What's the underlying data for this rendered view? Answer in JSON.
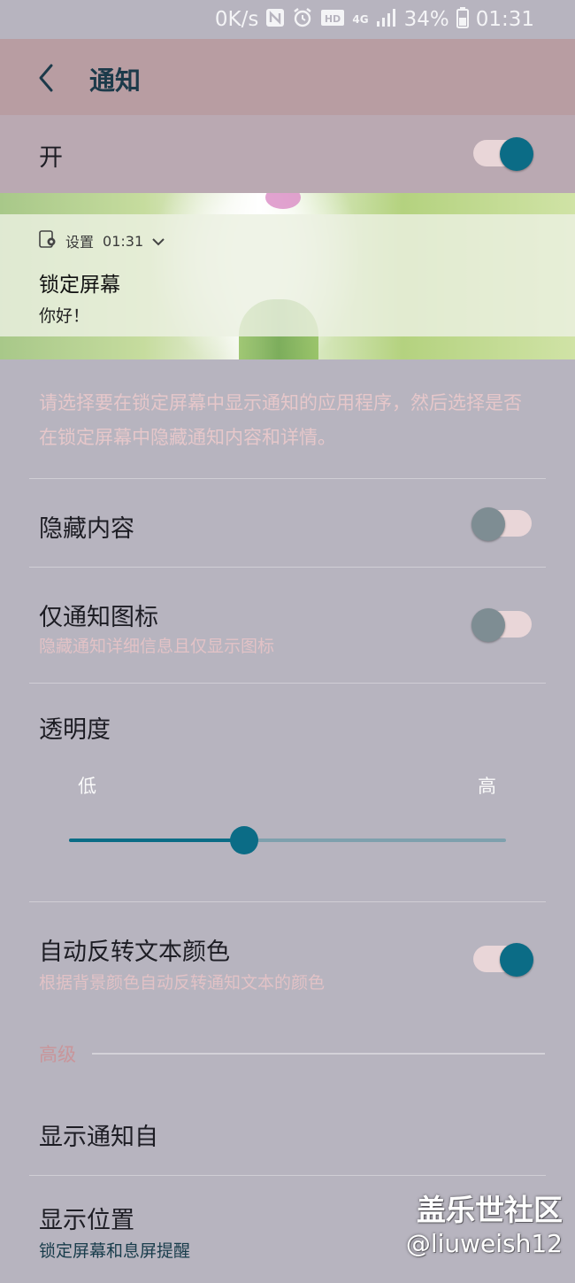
{
  "status_bar": {
    "net_speed": "0K/s",
    "icons": [
      "nfc-icon",
      "alarm-icon",
      "hd-voice-icon",
      "4g-icon",
      "signal-icon",
      "battery-icon"
    ],
    "hd_label": "HD",
    "lte_label": "4G",
    "battery": "34%",
    "time": "01:31"
  },
  "app_bar": {
    "title": "通知"
  },
  "master": {
    "label": "开",
    "on": true
  },
  "preview": {
    "app_name": "设置",
    "time": "01:31",
    "title": "锁定屏幕",
    "body": "你好！"
  },
  "description": "请选择要在锁定屏幕中显示通知的应用程序，然后选择是否在锁定屏幕中隐藏通知内容和详情。",
  "settings": {
    "hide_content": {
      "label": "隐藏内容",
      "on": false
    },
    "icons_only": {
      "label": "仅通知图标",
      "sub": "隐藏通知详细信息且仅显示图标",
      "on": false
    },
    "transparency": {
      "label": "透明度",
      "low": "低",
      "high": "高",
      "level": 0.4
    },
    "auto_reverse": {
      "label": "自动反转文本颜色",
      "sub": "根据背景颜色自动反转通知文本的颜色",
      "on": true
    }
  },
  "advanced": {
    "header": "高级",
    "show_from": {
      "label": "显示通知自"
    },
    "position": {
      "label": "显示位置",
      "sub": "锁定屏幕和息屏提醒"
    }
  },
  "watermark": {
    "line1": "盖乐世社区",
    "line2": "@liuweish12"
  },
  "colors": {
    "accent": "#0b6c86",
    "app_bar": "#b89da2",
    "background": "#b7b4bf"
  }
}
